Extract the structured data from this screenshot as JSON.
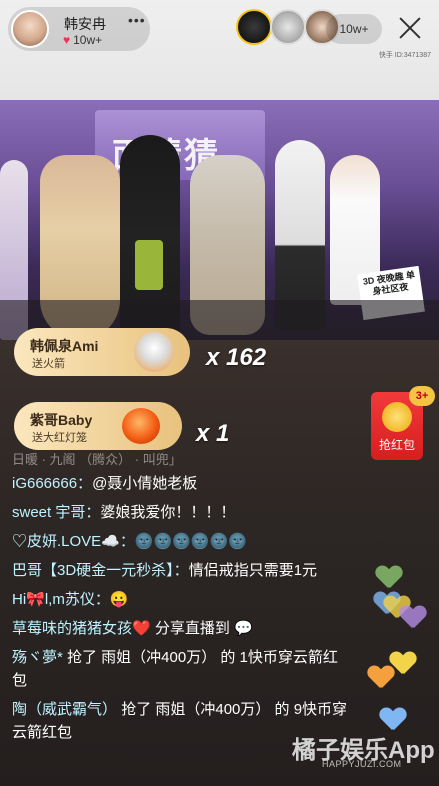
{
  "host": {
    "name": "韩安冉",
    "more": "•••",
    "likes": "10w+"
  },
  "viewers": {
    "count": "10w+"
  },
  "room_id": "快手 ID:3471387",
  "gifts": [
    {
      "sender": "韩佩泉Ami",
      "desc": "送火箭",
      "icon": "rocket-icon",
      "count": "x 162"
    },
    {
      "sender": "紫哥Baby",
      "desc": "送大红灯笼",
      "icon": "lantern-icon",
      "count": "x 1"
    }
  ],
  "red_packet": {
    "label": "抢红包",
    "badge": "3+"
  },
  "stage": {
    "banner": "面猜猜",
    "logo": "3D 夜晚趣 单身社区夜"
  },
  "comments": [
    {
      "text": "日暖 · 九阁 （腾众） · 叫兜」"
    },
    {
      "user": "iG666666：",
      "text": "@聂小倩她老板"
    },
    {
      "user": "sweet 宇哥：",
      "text": "婆娘我爱你！！！！"
    },
    {
      "user": "♡皮妍.LOVE☁️：",
      "text": "🌚🌚🌚🌚🌚🌚"
    },
    {
      "user": "巴哥【3D硬金一元秒杀】：",
      "text": "情侣戒指只需要1元"
    },
    {
      "user": "Hi🎀l,m苏仪：",
      "text": "😛"
    },
    {
      "user": "草莓味的猪猪女孩❤️",
      "text": "分享直播到 💬"
    },
    {
      "user": "殇ヾ夢*",
      "text": "抢了 雨姐（冲400万） 的 1快币穿云箭红包"
    },
    {
      "user": "陶（威武霸气）",
      "text": "抢了 雨姐（冲400万） 的 9快币穿云箭红包"
    }
  ],
  "watermark": {
    "main": "橘子娱乐App",
    "sub": "HAPPYJUZI.COM"
  },
  "colors": {
    "gift_bg": "#f0d196",
    "red_packet": "#e52a2a",
    "comment_user": "#bff3ff"
  }
}
